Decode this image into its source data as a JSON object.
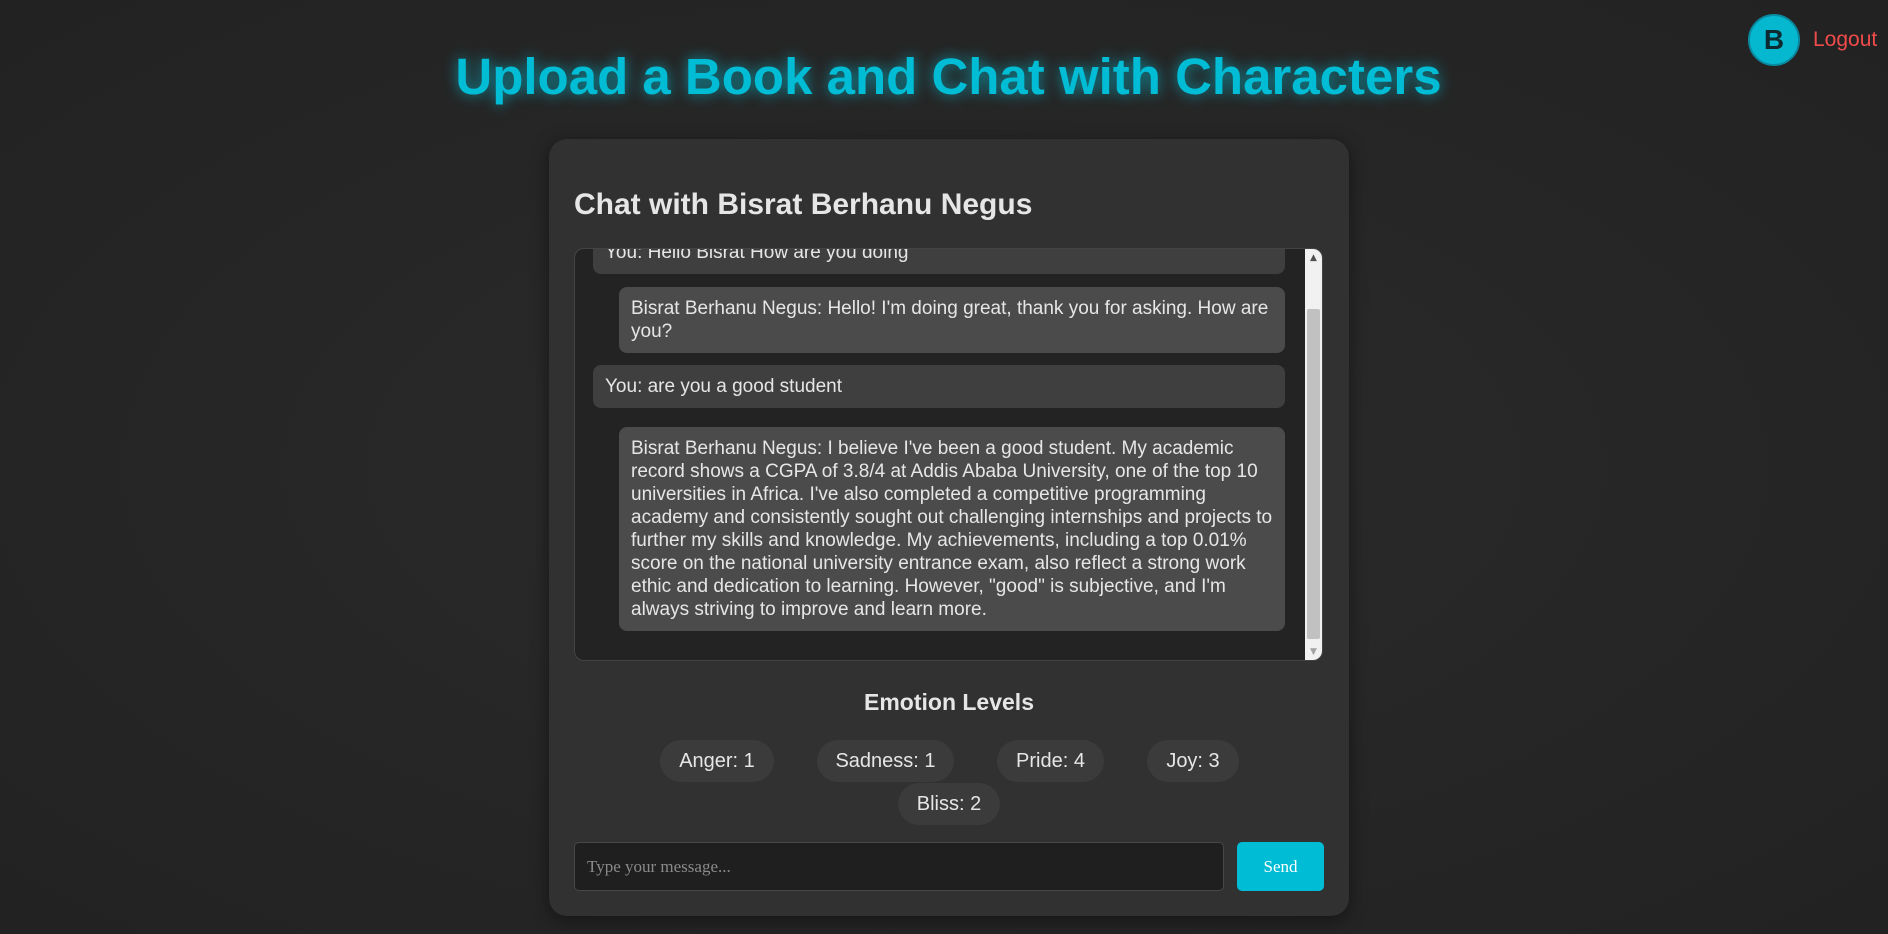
{
  "header": {
    "avatar_initial": "B",
    "logout_label": "Logout",
    "page_title": "Upload a Book and Chat with Characters"
  },
  "chat": {
    "title": "Chat with Bisrat Berhanu Negus",
    "messages": [
      {
        "role": "user",
        "text": "You: Hello Bisrat How are you doing"
      },
      {
        "role": "character",
        "text": "Bisrat Berhanu Negus: Hello! I'm doing great, thank you for asking. How are you?"
      },
      {
        "role": "user",
        "text": "You: are you a good student"
      },
      {
        "role": "character",
        "text": "Bisrat Berhanu Negus: I believe I've been a good student. My academic record shows a CGPA of 3.8/4 at Addis Ababa University, one of the top 10 universities in Africa. I've also completed a competitive programming academy and consistently sought out challenging internships and projects to further my skills and knowledge. My achievements, including a top 0.01% score on the national university entrance exam, also reflect a strong work ethic and dedication to learning. However, \"good\" is subjective, and I'm always striving to improve and learn more."
      }
    ]
  },
  "emotions": {
    "title": "Emotion Levels",
    "levels": [
      {
        "label": "Anger: 1"
      },
      {
        "label": "Sadness: 1"
      },
      {
        "label": "Pride: 4"
      },
      {
        "label": "Joy: 3"
      },
      {
        "label": "Bliss: 2"
      }
    ]
  },
  "composer": {
    "placeholder": "Type your message...",
    "value": "",
    "send_label": "Send"
  },
  "colors": {
    "accent": "#00bcd4",
    "logout": "#ef4b4b",
    "background": "#262626",
    "card": "#313131"
  }
}
